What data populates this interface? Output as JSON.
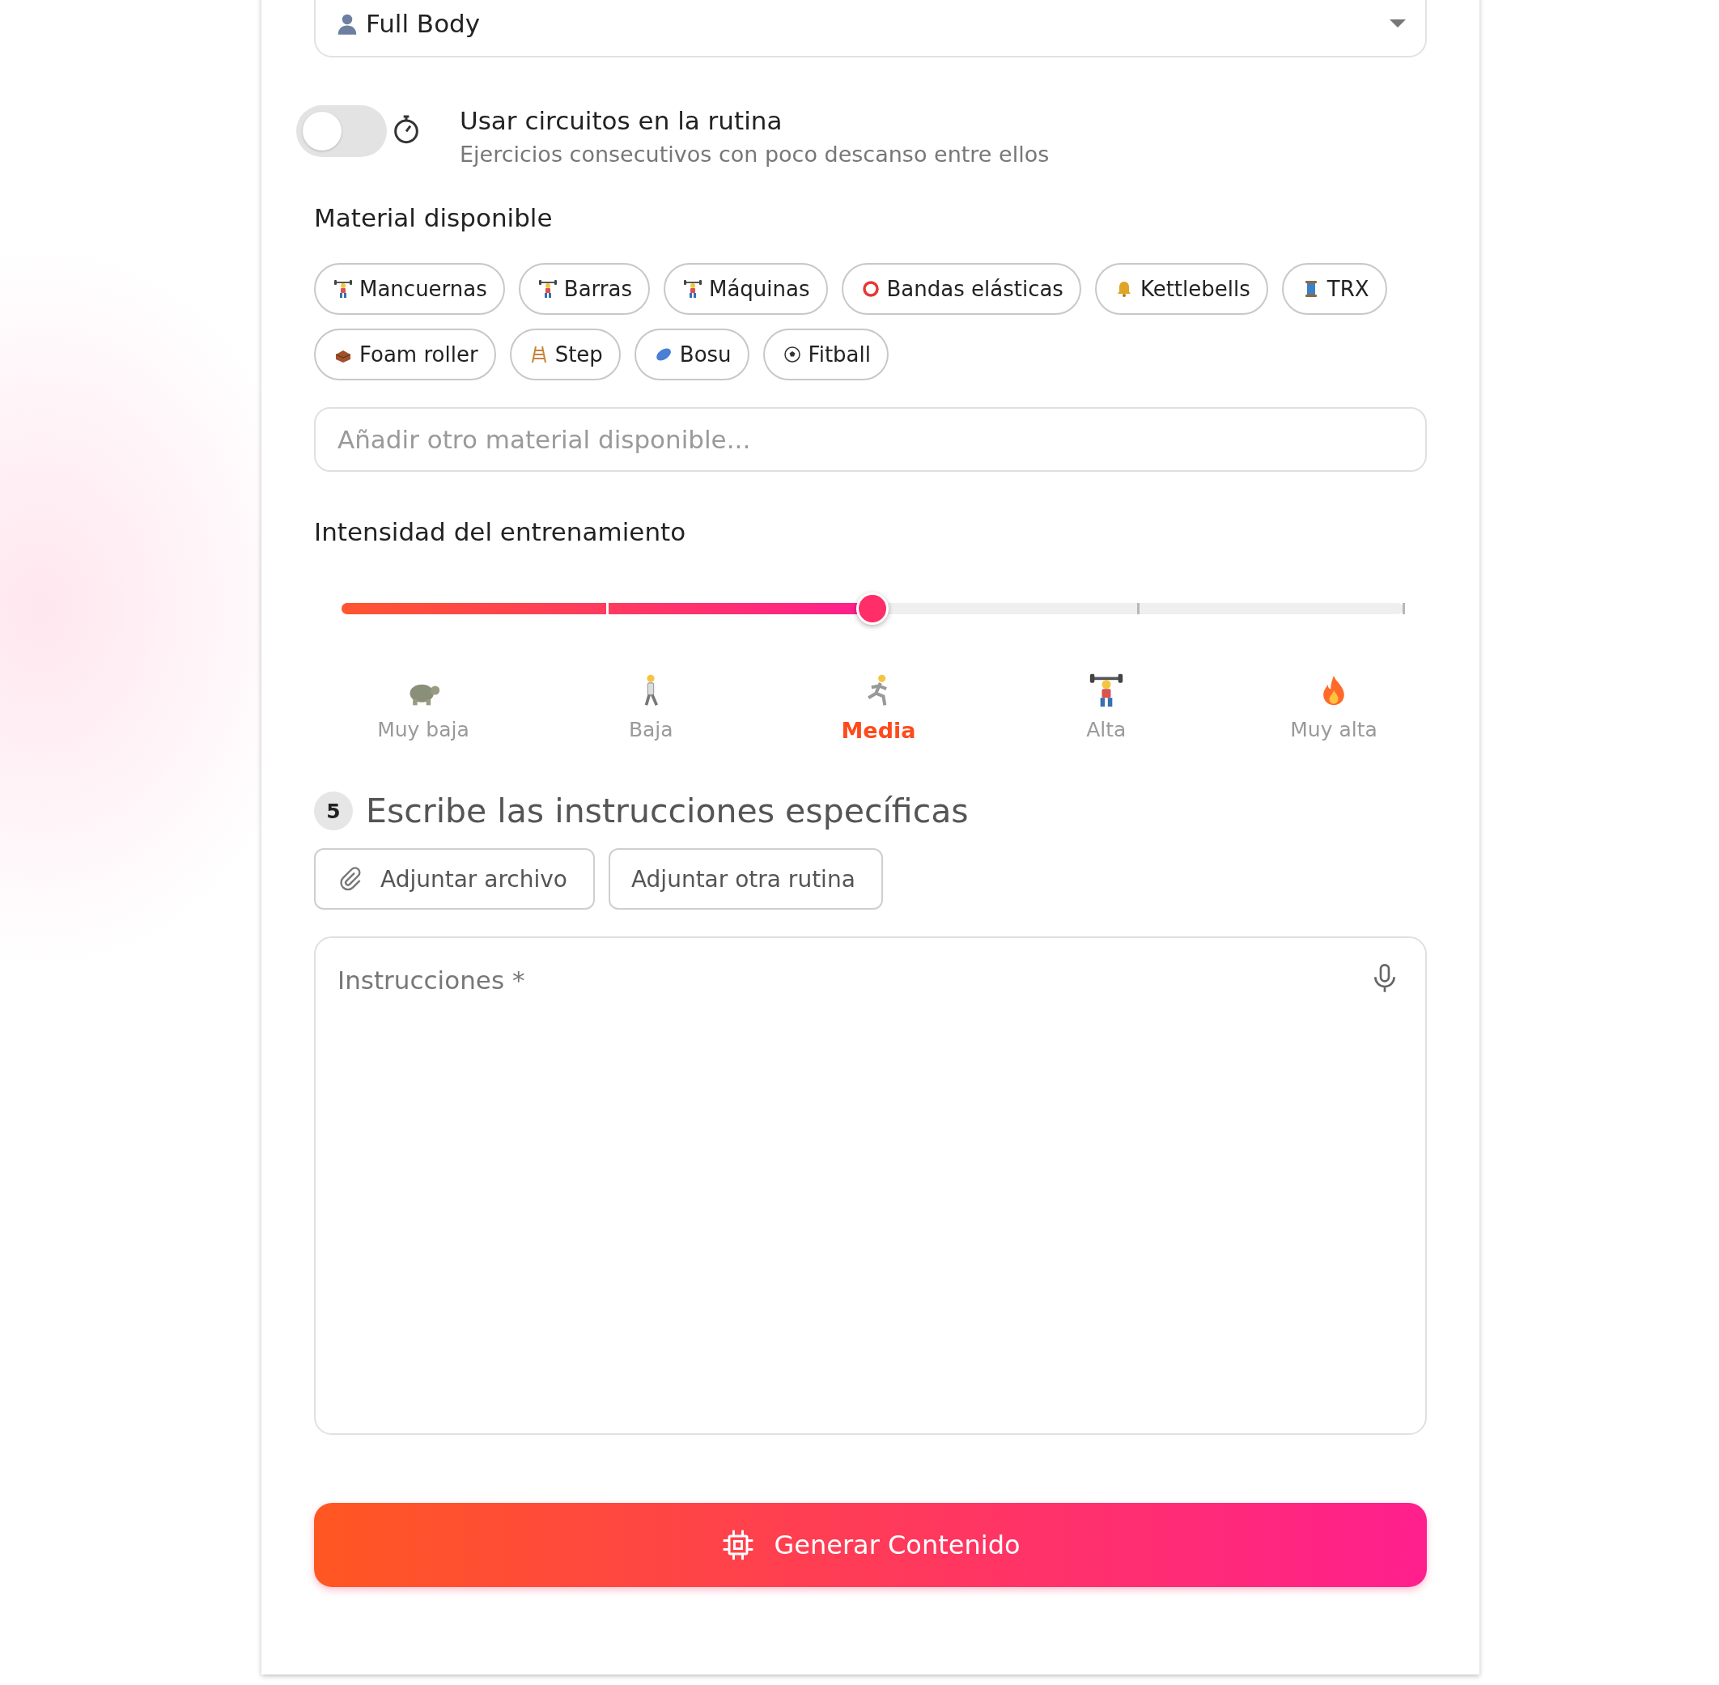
{
  "workout_type_select": {
    "value": "Full Body"
  },
  "circuits": {
    "on": false,
    "title": "Usar circuitos en la rutina",
    "description": "Ejercicios consecutivos con poco descanso entre ellos"
  },
  "equipment": {
    "heading": "Material disponible",
    "chips": [
      {
        "label": "Mancuernas",
        "selected": false
      },
      {
        "label": "Barras",
        "selected": false
      },
      {
        "label": "Máquinas",
        "selected": false
      },
      {
        "label": "Bandas elásticas",
        "selected": false
      },
      {
        "label": "Kettlebells",
        "selected": false
      },
      {
        "label": "TRX",
        "selected": false
      },
      {
        "label": "Foam roller",
        "selected": false
      },
      {
        "label": "Step",
        "selected": false
      },
      {
        "label": "Bosu",
        "selected": false
      },
      {
        "label": "Fitball",
        "selected": false
      }
    ],
    "other_field": {
      "placeholder": "Añadir otro material disponible..."
    }
  },
  "intensity": {
    "heading": "Intensidad del entrenamiento",
    "level": 0.5,
    "levels": [
      {
        "label": "Muy baja",
        "selected": false
      },
      {
        "label": "Baja",
        "selected": false
      },
      {
        "label": "Media",
        "selected": true
      },
      {
        "label": "Alta",
        "selected": false
      },
      {
        "label": "Muy alta",
        "selected": false
      }
    ]
  },
  "step": {
    "number": "5",
    "title": "Escribe las instrucciones específicas"
  },
  "attach_buttons": [
    {
      "label": "Adjuntar archivo",
      "kind": "file"
    },
    {
      "label": "Adjuntar otra rutina",
      "kind": "plain"
    }
  ],
  "instructions_field": {
    "placeholder": "Instrucciones *"
  },
  "generate_button": {
    "label": "Generar Contenido"
  }
}
